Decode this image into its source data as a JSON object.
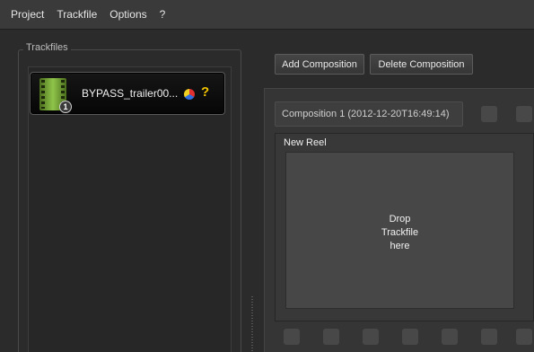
{
  "menu": {
    "items": [
      "Project",
      "Trackfile",
      "Options",
      "?"
    ]
  },
  "trackfiles": {
    "group_title": "Trackfiles",
    "items": [
      {
        "name": "BYPASS_trailer00...",
        "badge": "1",
        "icon": "film-reel-icon",
        "status_icons": [
          "color-wheel-icon",
          "question-icon"
        ],
        "status_glyph": "?"
      }
    ]
  },
  "toolbar": {
    "add_label": "Add Composition",
    "delete_label": "Delete Composition"
  },
  "composition": {
    "tab_label": "Composition 1 (2012-12-20T16:49:14)",
    "reel_title": "New Reel",
    "drop_lines": [
      "Drop",
      "Trackfile",
      "here"
    ]
  },
  "colors": {
    "background": "#2b2b2b",
    "menubar": "#3a3a3a",
    "film_green": "#8fc54a",
    "question_yellow": "#f2c400"
  }
}
